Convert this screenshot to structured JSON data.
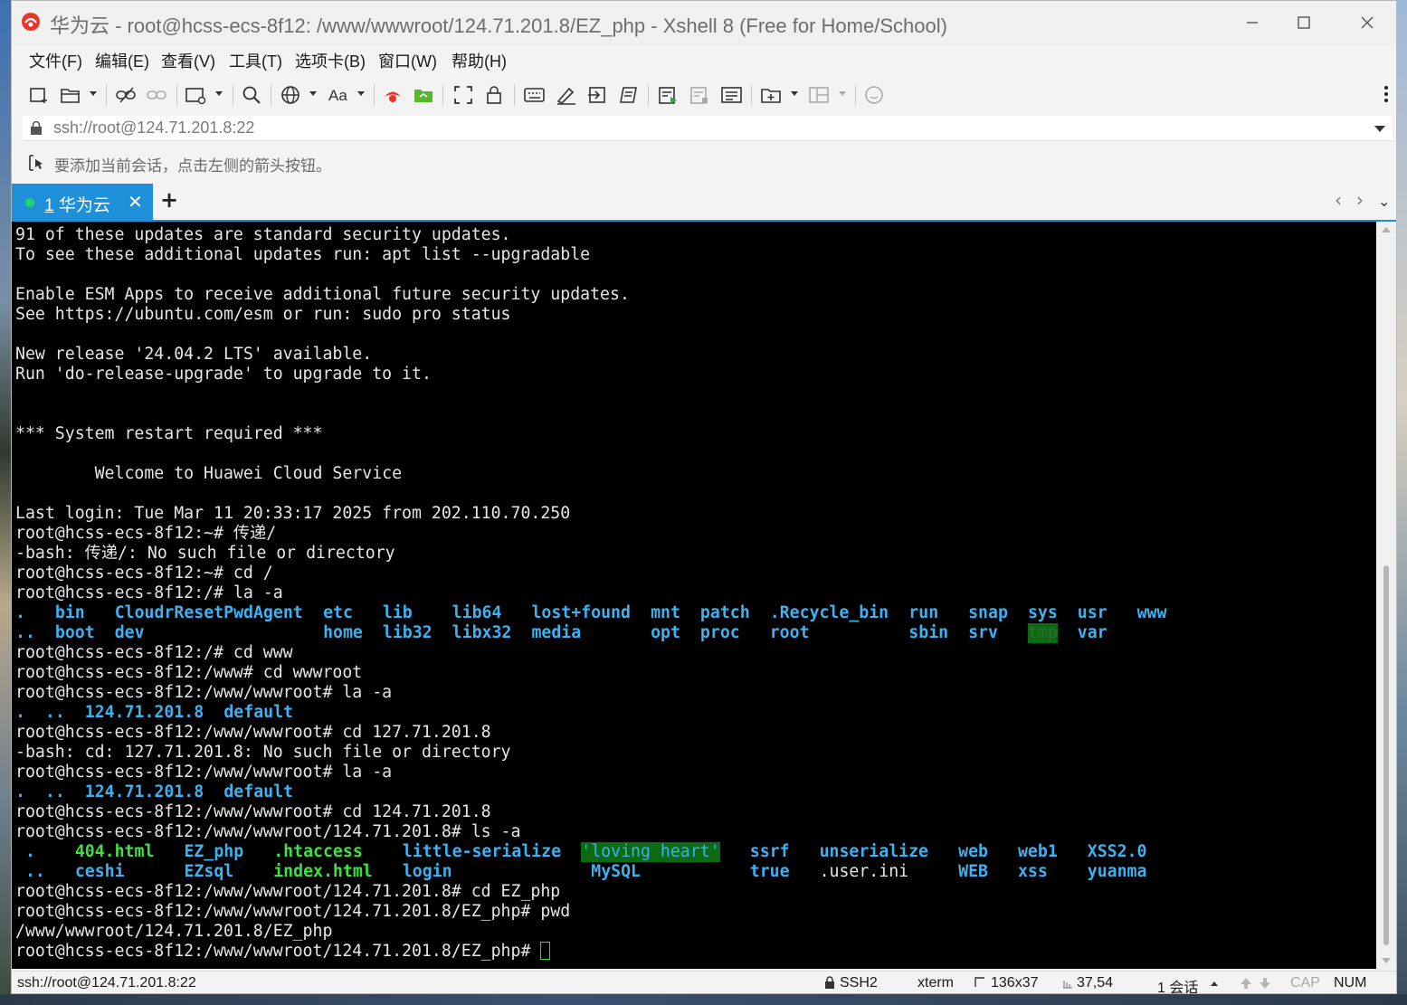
{
  "window": {
    "title": "华为云 - root@hcss-ecs-8f12: /www/wwwroot/124.71.201.8/EZ_php - Xshell 8 (Free for Home/School)"
  },
  "menu": [
    "文件(F)",
    "编辑(E)",
    "查看(V)",
    "工具(T)",
    "选项卡(B)",
    "窗口(W)",
    "帮助(H)"
  ],
  "address": {
    "value": "ssh://root@124.71.201.8:22"
  },
  "hint": {
    "text": "要添加当前会话，点击左侧的箭头按钮。"
  },
  "tabs": [
    {
      "index": "1",
      "label": "华为云",
      "status": "connected"
    }
  ],
  "terminal": {
    "lines": [
      "91 of these updates are standard security updates.",
      "To see these additional updates run: apt list --upgradable",
      "",
      "Enable ESM Apps to receive additional future security updates.",
      "See https://ubuntu.com/esm or run: sudo pro status",
      "",
      "New release '24.04.2 LTS' available.",
      "Run 'do-release-upgrade' to upgrade to it.",
      "",
      "",
      "*** System restart required ***",
      "",
      "        Welcome to Huawei Cloud Service",
      "",
      "Last login: Tue Mar 11 20:33:17 2025 from 202.110.70.250",
      "root@hcss-ecs-8f12:~# 传递/",
      "-bash: 传递/: No such file or directory",
      "root@hcss-ecs-8f12:~# cd /",
      "root@hcss-ecs-8f12:/# la -a",
      "__LS_ROOT_1__",
      "__LS_ROOT_2__",
      "root@hcss-ecs-8f12:/# cd www",
      "root@hcss-ecs-8f12:/www# cd wwwroot",
      "root@hcss-ecs-8f12:/www/wwwroot# la -a",
      "__LS_WWW_A__",
      "root@hcss-ecs-8f12:/www/wwwroot# cd 127.71.201.8",
      "-bash: cd: 127.71.201.8: No such file or directory",
      "root@hcss-ecs-8f12:/www/wwwroot# la -a",
      "__LS_WWW_B__",
      "root@hcss-ecs-8f12:/www/wwwroot# cd 124.71.201.8",
      "root@hcss-ecs-8f12:/www/wwwroot/124.71.201.8# ls -a",
      "__LS_SITE_1__",
      "__LS_SITE_2__",
      "root@hcss-ecs-8f12:/www/wwwroot/124.71.201.8# cd EZ_php",
      "root@hcss-ecs-8f12:/www/wwwroot/124.71.201.8/EZ_php# pwd",
      "/www/wwwroot/124.71.201.8/EZ_php",
      "root@hcss-ecs-8f12:/www/wwwroot/124.71.201.8/EZ_php# "
    ],
    "ls_root_1": [
      {
        "t": ".",
        "k": "dir"
      },
      {
        "t": "bin",
        "k": "dir"
      },
      {
        "t": "CloudrResetPwdAgent",
        "k": "dir"
      },
      {
        "t": "etc",
        "k": "dir"
      },
      {
        "t": "lib",
        "k": "dir"
      },
      {
        "t": "lib64",
        "k": "dir"
      },
      {
        "t": "lost+found",
        "k": "dir"
      },
      {
        "t": "mnt",
        "k": "dir"
      },
      {
        "t": "patch",
        "k": "dir"
      },
      {
        "t": ".Recycle_bin",
        "k": "dir"
      },
      {
        "t": "run",
        "k": "dir"
      },
      {
        "t": "snap",
        "k": "dir"
      },
      {
        "t": "sys",
        "k": "dir"
      },
      {
        "t": "usr",
        "k": "dir"
      },
      {
        "t": "www",
        "k": "dir"
      }
    ],
    "ls_root_2": [
      {
        "t": "..",
        "k": "dir"
      },
      {
        "t": "boot",
        "k": "dir"
      },
      {
        "t": "dev",
        "k": "dir"
      },
      {
        "t": "home",
        "k": "dir"
      },
      {
        "t": "lib32",
        "k": "dir"
      },
      {
        "t": "libx32",
        "k": "dir"
      },
      {
        "t": "media",
        "k": "dir"
      },
      {
        "t": "opt",
        "k": "dir"
      },
      {
        "t": "proc",
        "k": "dir"
      },
      {
        "t": "root",
        "k": "dir"
      },
      {
        "t": "sbin",
        "k": "dir"
      },
      {
        "t": "srv",
        "k": "dir"
      },
      {
        "t": "tmp",
        "k": "tmp"
      },
      {
        "t": "var",
        "k": "dir"
      }
    ],
    "ls_www": [
      {
        "t": ".",
        "k": "dir"
      },
      {
        "t": "..",
        "k": "dir"
      },
      {
        "t": "124.71.201.8",
        "k": "dir"
      },
      {
        "t": "default",
        "k": "dir"
      }
    ],
    "ls_site_1": [
      {
        "t": ".",
        "k": "dir"
      },
      {
        "t": "404.html",
        "k": "exe"
      },
      {
        "t": "EZ_php",
        "k": "dir"
      },
      {
        "t": ".htaccess",
        "k": "exe"
      },
      {
        "t": "little-serialize",
        "k": "dir"
      },
      {
        "t": "'loving heart'",
        "k": "hl"
      },
      {
        "t": "ssrf",
        "k": "dir"
      },
      {
        "t": "unserialize",
        "k": "dir"
      },
      {
        "t": "web",
        "k": "dir"
      },
      {
        "t": "web1",
        "k": "dir"
      },
      {
        "t": "XSS2.0",
        "k": "dir"
      }
    ],
    "ls_site_2": [
      {
        "t": "..",
        "k": "dir"
      },
      {
        "t": "ceshi",
        "k": "dir"
      },
      {
        "t": "EZsql",
        "k": "dir"
      },
      {
        "t": "index.html",
        "k": "exe"
      },
      {
        "t": "login",
        "k": "dir"
      },
      {
        "t": "MySQL",
        "k": "dir"
      },
      {
        "t": "true",
        "k": "dir"
      },
      {
        "t": ".user.ini",
        "k": "plain"
      },
      {
        "t": "WEB",
        "k": "dir"
      },
      {
        "t": "xss",
        "k": "dir"
      },
      {
        "t": "yuanma",
        "k": "dir"
      }
    ]
  },
  "status": {
    "connection": "ssh://root@124.71.201.8:22",
    "protocol": "SSH2",
    "term": "xterm",
    "size": "136x37",
    "cursor_pos": "37,54",
    "sessions": "1 会话",
    "cap": "CAP",
    "num": "NUM"
  },
  "colors": {
    "accent": "#1e8fd9",
    "dir": "#3fb0f0",
    "exe": "#3fe03f",
    "highlight_bg": "#0b6a12"
  }
}
